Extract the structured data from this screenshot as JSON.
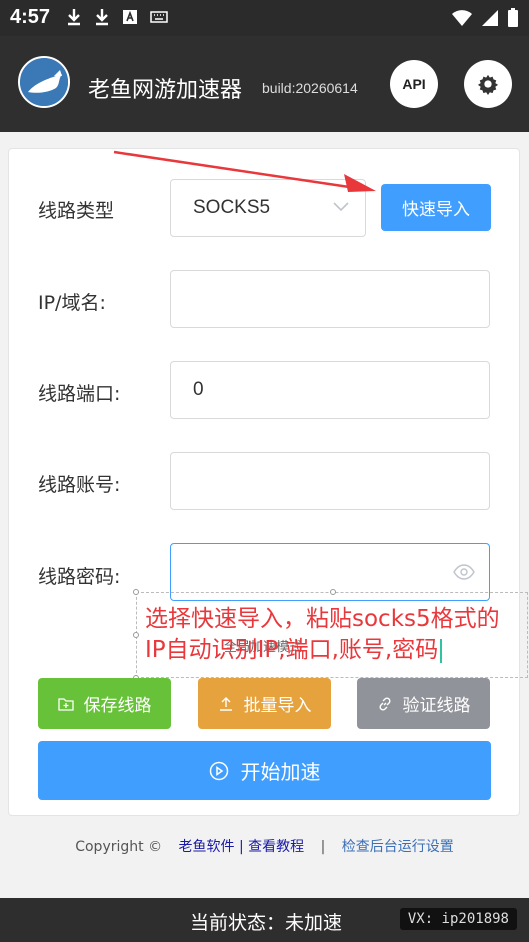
{
  "status_bar": {
    "time": "4:57"
  },
  "header": {
    "title": "老鱼网游加速器",
    "build": "build:20260614",
    "api_label": "API"
  },
  "form": {
    "line_type_label": "线路类型",
    "line_type_value": "SOCKS5",
    "quick_import_label": "快速导入",
    "ip_label": "IP/域名:",
    "ip_value": "",
    "port_label": "线路端口:",
    "port_value": "0",
    "account_label": "线路账号:",
    "account_value": "",
    "password_label": "线路密码:",
    "password_value": ""
  },
  "annotation": {
    "line1": "选择快速导入，粘贴socks5格式的",
    "line2": "IP自动识别IP,端口,账号,密码",
    "underlying": "全局加速模式"
  },
  "actions": {
    "save": "保存线路",
    "batch_import": "批量导入",
    "verify": "验证线路",
    "start": "开始加速"
  },
  "footer": {
    "copyright": "Copyright ©",
    "link_tutorial": "老鱼软件 | 查看教程",
    "separator": "|",
    "link_settings": "检查后台运行设置"
  },
  "status": {
    "current": "当前状态：未加速",
    "vx": "VX: ip201898"
  },
  "colors": {
    "primary": "#409eff",
    "success": "#67c23a",
    "warning": "#e6a23c",
    "info": "#909399",
    "annotation": "#e8383c"
  }
}
